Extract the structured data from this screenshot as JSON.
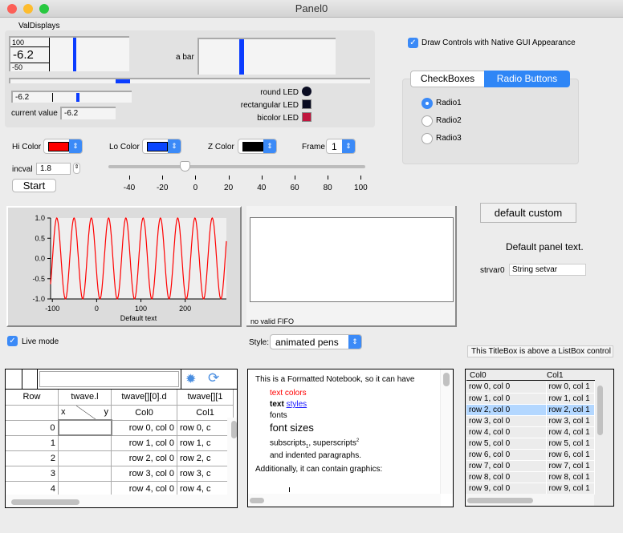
{
  "window": {
    "title": "Panel0"
  },
  "valdisplays": {
    "title": "ValDisplays",
    "top_limit": "100",
    "value_big": "-6.2",
    "bottom_limit": "-50",
    "bar_label": "a bar",
    "small_value": "-6.2",
    "current_value_label": "current value",
    "current_value": "-6.2",
    "bar_fraction": 0.38
  },
  "leds": {
    "round_label": "round LED",
    "rect_label": "rectangular LED",
    "bicolor_label": "bicolor LED",
    "round_color": "#0a0c22",
    "rect_color": "#0a0c22",
    "bicolor_color": "#c0163e"
  },
  "controls": {
    "hi_color_label": "Hi Color",
    "hi_color": "#ff0000",
    "lo_color_label": "Lo Color",
    "lo_color": "#0a46ff",
    "z_color_label": "Z Color",
    "z_color": "#000000",
    "frame_label": "Frame",
    "frame_value": "1",
    "incval_label": "incval",
    "incval_value": "1.8",
    "start_label": "Start",
    "slider_value": -6.2,
    "slider_ticks": [
      "-40",
      "-20",
      "0",
      "20",
      "40",
      "60",
      "80",
      "100"
    ]
  },
  "native_gui": {
    "label": "Draw Controls with Native GUI Appearance",
    "checked": true
  },
  "tabs": {
    "items": [
      "CheckBoxes",
      "Radio Buttons"
    ],
    "active": 1,
    "radios": [
      "Radio1",
      "Radio2",
      "Radio3"
    ],
    "selected": 0
  },
  "graph": {
    "xlabel": "Default text",
    "yticks": [
      "1.0",
      "0.5",
      "0.0",
      "-0.5",
      "-1.0"
    ],
    "xticks": [
      "-100",
      "0",
      "100",
      "200"
    ],
    "line_color": "#ff0000"
  },
  "chart_data": {
    "type": "line",
    "xlabel": "Default text",
    "xlim": [
      -104,
      293
    ],
    "ylim": [
      -1,
      1
    ],
    "series": [
      {
        "function": "sine",
        "amplitude": 1,
        "period": 39,
        "first_peak_x": -90
      }
    ]
  },
  "fifo": {
    "status": "no valid FIFO"
  },
  "live_mode": {
    "label": "Live mode",
    "checked": true
  },
  "style": {
    "label": "Style:",
    "value": "animated pens"
  },
  "custom_button": "default custom",
  "panel_text": "Default panel text.",
  "strvar": {
    "label": "strvar0",
    "value": "String setvar"
  },
  "titlebox": "This TitleBox is above a ListBox control",
  "table": {
    "headers": [
      "Row",
      "twave.l",
      "twave[][0].d",
      "twave[][1"
    ],
    "subheaders": [
      "",
      "x",
      "y",
      "Col0",
      "Col1"
    ],
    "rows": [
      [
        "0",
        "",
        "row 0, col 0",
        "row 0, c"
      ],
      [
        "1",
        "",
        "row 1, col 0",
        "row 1, c"
      ],
      [
        "2",
        "",
        "row 2, col 0",
        "row 2, c"
      ],
      [
        "3",
        "",
        "row 3, col 0",
        "row 3, c"
      ],
      [
        "4",
        "",
        "row 4, col 0",
        "row 4, c"
      ]
    ]
  },
  "notebook": {
    "line1": "This is a Formatted Notebook, so it can have",
    "colors": "text colors",
    "text_bold": "text",
    "styles": "styles",
    "fonts": "fonts",
    "sizes": "font sizes",
    "subscripts": "subscripts",
    "sub": "1",
    "superscripts": "superscripts",
    "sup": "2",
    "indented": "and indented paragraphs.",
    "graphics": "Additionally, it can contain graphics:"
  },
  "listbox": {
    "headers": [
      "Col0",
      "Col1"
    ],
    "selected": 2,
    "rows": [
      [
        "row 0, col 0",
        "row 0, col 1"
      ],
      [
        "row 1, col 0",
        "row 1, col 1"
      ],
      [
        "row 2, col 0",
        "row 2, col 1"
      ],
      [
        "row 3, col 0",
        "row 3, col 1"
      ],
      [
        "row 4, col 0",
        "row 4, col 1"
      ],
      [
        "row 5, col 0",
        "row 5, col 1"
      ],
      [
        "row 6, col 0",
        "row 6, col 1"
      ],
      [
        "row 7, col 0",
        "row 7, col 1"
      ],
      [
        "row 8, col 0",
        "row 8, col 1"
      ],
      [
        "row 9, col 0",
        "row 9, col 1"
      ]
    ]
  }
}
